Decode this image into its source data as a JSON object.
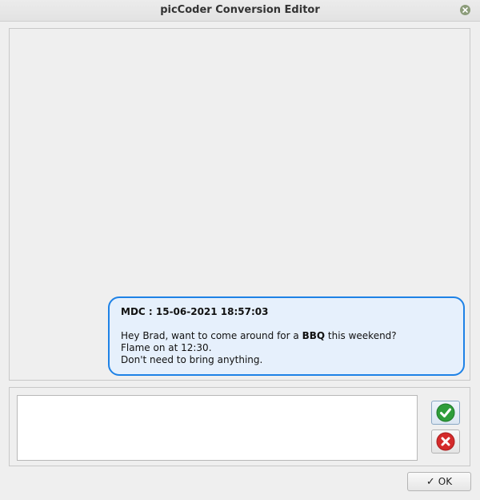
{
  "window": {
    "title": "picCoder Conversion Editor"
  },
  "message": {
    "header": "MDC : 15-06-2021 18:57:03",
    "line1_pre": "Hey Brad, want to come around for a ",
    "line1_bold": "BBQ",
    "line1_post": " this weekend?",
    "line2": "Flame on at 12:30.",
    "line3": "Don't need to bring anything."
  },
  "compose": {
    "value": ""
  },
  "buttons": {
    "ok_label": "OK",
    "ok_icon": "checkmark-icon",
    "accept_icon": "green-check-circle-icon",
    "reject_icon": "red-x-circle-icon"
  },
  "colors": {
    "bubble_border": "#1e82e6",
    "bubble_fill": "#e6f0fc",
    "accept_green": "#2e9d3a",
    "reject_red": "#d42a2a"
  }
}
